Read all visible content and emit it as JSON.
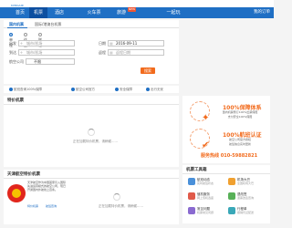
{
  "logo": {
    "wordmark": "",
    "sub": "KUNGAIR"
  },
  "nav": {
    "items": [
      "首页",
      "机票",
      "酒店",
      "火车票",
      "旅游",
      "一起玩"
    ],
    "active_index": 1,
    "new_badge": "NEW",
    "right_label": "我的订单"
  },
  "search": {
    "tabs": [
      "国内机票",
      "国际/港澳台机票"
    ],
    "trip_types": [
      "单程",
      "往返",
      "联程"
    ],
    "from_label": "出发",
    "to_label": "到达",
    "from_placeholder": "城市/机场",
    "to_placeholder": "城市/机场",
    "date_label": "日期",
    "date_value": "2016-09-11",
    "return_label": "返程",
    "return_placeholder": "返程日期",
    "airline_label": "航空公司",
    "airline_value": "不限",
    "button": "搜索"
  },
  "hints": [
    "航班查询100%保障",
    "航空公司官方",
    "安全保障",
    "出行无忧"
  ],
  "special": {
    "title": "特价机票",
    "loading": "正在加载特价机票，请稍候……"
  },
  "airline_panel": {
    "title": "天津航空特价机票",
    "desc": "天津航空作为中国首家引入国际先进运营模式的航空公司，现已开通国内外航线上百条。",
    "links": [
      "特价机票",
      "航班查询"
    ],
    "loading": "正在加载特价机票，请稍候……"
  },
  "ad": {
    "title1": "100%保障体系",
    "line1": "国内机票预订100%出票保障",
    "line2": "支付安全100%保障",
    "title2": "100%航班认证",
    "line3": "航空公司官方授权",
    "line4": "航班信息实时更新",
    "phone": "服务热线 010-59882821"
  },
  "tools": {
    "title": "机票工具箱",
    "items": [
      {
        "name": "航班动态",
        "sub": "实时航班状态"
      },
      {
        "name": "机场大巴",
        "sub": "全国机场大巴"
      },
      {
        "name": "值机服务",
        "sub": "网上值机选座"
      },
      {
        "name": "退改签",
        "sub": "退票改签查询"
      },
      {
        "name": "常见问题",
        "sub": "机票常见问题"
      },
      {
        "name": "行程单",
        "sub": "报销凭证配送"
      }
    ]
  },
  "colors": {
    "brand": "#1f6fc4",
    "accent": "#f26b1d",
    "airline_red": "#e1261c",
    "airline_yellow": "#f6c200"
  }
}
